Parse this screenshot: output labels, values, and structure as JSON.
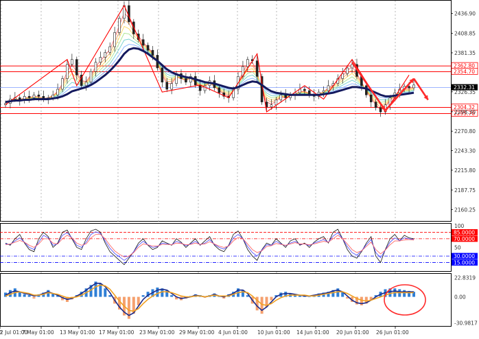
{
  "chart_data": [
    {
      "type": "line",
      "title": "",
      "xlabel": "",
      "ylabel": "",
      "price_ticks": [
        "2436.90",
        "2408.85",
        "2381.35",
        "2326.35",
        "2298.30",
        "2270.80",
        "2243.30",
        "2215.80",
        "2187.75",
        "2160.25"
      ],
      "ylim": [
        2148,
        2452
      ],
      "time_labels": [
        "7 May 01:00",
        "13 May 01:00",
        "17 May 01:00",
        "23 May 01:00",
        "29 May 01:00",
        "4 Jun 01:00",
        "10 Jun 01:00",
        "14 Jun 01:00",
        "20 Jun 01:00",
        "26 Jun 01:00",
        "2 Jul 01:00"
      ],
      "x_cut_label": "0",
      "price_series_desc": "candlestick price with ribbon of moving averages and thick navy moving average",
      "close": [
        2310,
        2316,
        2318,
        2314,
        2320,
        2318,
        2322,
        2320,
        2316,
        2318,
        2322,
        2330,
        2345,
        2365,
        2372,
        2350,
        2335,
        2340,
        2355,
        2368,
        2375,
        2382,
        2390,
        2410,
        2430,
        2448,
        2425,
        2408,
        2400,
        2392,
        2385,
        2378,
        2360,
        2340,
        2330,
        2338,
        2352,
        2345,
        2340,
        2348,
        2336,
        2328,
        2335,
        2342,
        2332,
        2325,
        2320,
        2318,
        2330,
        2348,
        2362,
        2372,
        2370,
        2348,
        2312,
        2305,
        2308,
        2315,
        2322,
        2318,
        2322,
        2325,
        2330,
        2328,
        2322,
        2320,
        2326,
        2328,
        2335,
        2338,
        2345,
        2352,
        2360,
        2365,
        2348,
        2335,
        2322,
        2312,
        2304,
        2298,
        2308,
        2318,
        2325,
        2330,
        2334,
        2332,
        2336
      ],
      "ma_slow": [
        2312,
        2313,
        2314,
        2314,
        2315,
        2315,
        2316,
        2316,
        2316,
        2316,
        2317,
        2318,
        2320,
        2323,
        2327,
        2329,
        2331,
        2333,
        2336,
        2340,
        2345,
        2350,
        2356,
        2363,
        2371,
        2380,
        2386,
        2388,
        2387,
        2384,
        2380,
        2375,
        2370,
        2364,
        2358,
        2354,
        2351,
        2349,
        2347,
        2346,
        2344,
        2342,
        2340,
        2339,
        2338,
        2336,
        2334,
        2332,
        2331,
        2333,
        2336,
        2339,
        2341,
        2340,
        2336,
        2331,
        2327,
        2325,
        2324,
        2323,
        2322,
        2322,
        2322,
        2322,
        2322,
        2322,
        2322,
        2323,
        2324,
        2325,
        2327,
        2329,
        2331,
        2333,
        2333,
        2332,
        2331,
        2328,
        2325,
        2322,
        2320,
        2320,
        2321,
        2322,
        2323,
        2324,
        2325
      ],
      "ribbon_fast": [
        2311,
        2315,
        2317,
        2315,
        2318,
        2318,
        2320,
        2319,
        2317,
        2318,
        2321,
        2327,
        2338,
        2355,
        2365,
        2355,
        2342,
        2341,
        2350,
        2362,
        2370,
        2378,
        2386,
        2402,
        2420,
        2438,
        2430,
        2415,
        2405,
        2396,
        2389,
        2381,
        2367,
        2350,
        2338,
        2338,
        2347,
        2345,
        2342,
        2346,
        2339,
        2332,
        2334,
        2339,
        2334,
        2328,
        2323,
        2320,
        2326,
        2340,
        2354,
        2366,
        2368,
        2355,
        2326,
        2312,
        2309,
        2313,
        2319,
        2318,
        2320,
        2323,
        2327,
        2327,
        2324,
        2321,
        2324,
        2326,
        2332,
        2336,
        2342,
        2349,
        2356,
        2362,
        2352,
        2340,
        2328,
        2317,
        2308,
        2301,
        2305,
        2314,
        2321,
        2327,
        2331,
        2331,
        2334
      ],
      "trend_lines": [
        {
          "color": "#ff0000",
          "points": [
            [
              0,
              2308
            ],
            [
              13,
              2372
            ],
            [
              15,
              2335
            ],
            [
              25,
              2448
            ],
            [
              33,
              2326
            ],
            [
              41,
              2336
            ],
            [
              47,
              2318
            ],
            [
              53,
              2380
            ],
            [
              55,
              2298
            ],
            [
              63,
              2335
            ],
            [
              67,
              2316
            ],
            [
              73,
              2372
            ],
            [
              80,
              2298
            ],
            [
              85,
              2350
            ]
          ]
        }
      ],
      "horizontal_levels": [
        {
          "value": 2362.8,
          "label": "2362.80",
          "color": "#ff0000"
        },
        {
          "value": 2354.7,
          "label": "2354.70",
          "color": "#ff0000"
        },
        {
          "value": 2304.32,
          "label": "2304.32",
          "color": "#ff0000"
        },
        {
          "value": 2295.7,
          "label": "2295.70",
          "color": "#ff0000"
        }
      ],
      "current_price": {
        "value": 2332.31,
        "label": "2332.31",
        "color": "#000000",
        "line_color": "#7b9cff"
      },
      "arrows": [
        {
          "from": [
            73,
            2368
          ],
          "to": [
            80,
            2300
          ],
          "color": "#ff2a2a"
        },
        {
          "from": [
            80,
            2300
          ],
          "to": [
            86,
            2345
          ],
          "color": "#ff2a2a"
        },
        {
          "from": [
            86,
            2345
          ],
          "to": [
            89,
            2315
          ],
          "color": "#ff2a2a"
        }
      ]
    },
    {
      "type": "line",
      "title": "",
      "ylim": [
        0,
        100
      ],
      "tick_labels": [
        "100",
        "50"
      ],
      "levels": [
        {
          "value": 85,
          "label": "85.0000",
          "color": "#ff0000"
        },
        {
          "value": 70,
          "label": "70.0000",
          "color": "#ff0000"
        },
        {
          "value": 30,
          "label": "30.0000",
          "color": "#0000ff"
        },
        {
          "value": 15,
          "label": "15.0000",
          "color": "#0000ff"
        }
      ],
      "series": [
        {
          "color": "#111111",
          "values": [
            60,
            55,
            70,
            80,
            60,
            45,
            40,
            70,
            85,
            75,
            50,
            60,
            85,
            90,
            70,
            50,
            45,
            70,
            88,
            92,
            85,
            60,
            40,
            30,
            20,
            10,
            25,
            40,
            60,
            70,
            55,
            45,
            50,
            65,
            60,
            55,
            70,
            62,
            50,
            60,
            70,
            55,
            65,
            75,
            55,
            45,
            40,
            55,
            80,
            88,
            70,
            45,
            30,
            20,
            45,
            60,
            55,
            70,
            60,
            50,
            65,
            70,
            55,
            60,
            50,
            62,
            70,
            75,
            60,
            85,
            92,
            70,
            45,
            30,
            25,
            40,
            60,
            75,
            30,
            15,
            45,
            70,
            80,
            65,
            78,
            72,
            70
          ]
        },
        {
          "color": "#4444ff",
          "values": [
            58,
            57,
            65,
            72,
            62,
            50,
            45,
            62,
            78,
            72,
            55,
            58,
            78,
            84,
            72,
            55,
            50,
            62,
            80,
            86,
            82,
            65,
            48,
            36,
            28,
            20,
            28,
            40,
            55,
            64,
            56,
            50,
            52,
            60,
            58,
            56,
            64,
            60,
            54,
            58,
            64,
            56,
            60,
            68,
            57,
            50,
            46,
            54,
            72,
            80,
            70,
            52,
            38,
            30,
            44,
            56,
            55,
            64,
            58,
            54,
            60,
            64,
            57,
            58,
            54,
            60,
            64,
            68,
            62,
            76,
            84,
            70,
            52,
            38,
            32,
            42,
            56,
            68,
            38,
            26,
            44,
            62,
            72,
            66,
            72,
            70,
            68
          ]
        },
        {
          "color": "#ff5a5a",
          "values": [
            56,
            58,
            62,
            66,
            62,
            55,
            50,
            58,
            70,
            70,
            60,
            58,
            70,
            78,
            72,
            60,
            55,
            58,
            72,
            80,
            80,
            70,
            55,
            42,
            34,
            28,
            30,
            38,
            50,
            58,
            56,
            53,
            53,
            57,
            57,
            56,
            60,
            59,
            56,
            57,
            60,
            57,
            58,
            63,
            58,
            53,
            50,
            53,
            65,
            73,
            70,
            58,
            45,
            38,
            42,
            52,
            54,
            59,
            57,
            55,
            58,
            61,
            58,
            58,
            56,
            58,
            61,
            64,
            62,
            70,
            78,
            70,
            58,
            45,
            38,
            42,
            52,
            62,
            45,
            35,
            44,
            56,
            65,
            65,
            67,
            68,
            67
          ]
        }
      ]
    },
    {
      "type": "bar",
      "title": "",
      "ylim": [
        -32,
        24
      ],
      "tick_labels": [
        "22.8319",
        "0.00",
        "-30.9817"
      ],
      "histogram": [
        5,
        8,
        10,
        6,
        3,
        2,
        -2,
        3,
        5,
        8,
        4,
        2,
        -4,
        -6,
        -3,
        2,
        6,
        10,
        14,
        18,
        16,
        10,
        2,
        -8,
        -15,
        -22,
        -26,
        -20,
        -10,
        2,
        6,
        9,
        11,
        10,
        8,
        2,
        -3,
        -4,
        -2,
        1,
        3,
        2,
        -1,
        2,
        4,
        1,
        -2,
        3,
        6,
        10,
        8,
        2,
        -8,
        -16,
        -20,
        -12,
        -4,
        2,
        5,
        6,
        4,
        3,
        2,
        1,
        0,
        2,
        4,
        5,
        6,
        8,
        10,
        6,
        -2,
        -6,
        -9,
        -10,
        -8,
        -4,
        2,
        6,
        9,
        10,
        10,
        9,
        8,
        7,
        6
      ],
      "hist_pos_color": "#2f7fd6",
      "hist_neg_color": "#f5a06e",
      "series": [
        {
          "color": "#1b2a8a",
          "values": [
            2,
            5,
            7,
            6,
            4,
            3,
            1,
            2,
            4,
            6,
            4,
            2,
            -1,
            -3,
            -2,
            1,
            4,
            8,
            12,
            16,
            16,
            12,
            5,
            -4,
            -12,
            -18,
            -22,
            -19,
            -11,
            -3,
            2,
            5,
            8,
            9,
            8,
            4,
            0,
            -2,
            -1,
            0,
            2,
            1,
            0,
            1,
            3,
            1,
            0,
            2,
            4,
            8,
            8,
            4,
            -4,
            -11,
            -16,
            -12,
            -6,
            0,
            3,
            4,
            4,
            3,
            2,
            1,
            1,
            2,
            3,
            4,
            5,
            7,
            8,
            6,
            1,
            -4,
            -7,
            -8,
            -7,
            -4,
            0,
            3,
            5,
            6,
            7,
            6,
            6,
            6,
            6
          ]
        },
        {
          "color": "#f0a020",
          "values": [
            1,
            3,
            5,
            6,
            5,
            4,
            2,
            2,
            3,
            5,
            4,
            3,
            1,
            -1,
            -1,
            0,
            2,
            5,
            8,
            12,
            14,
            13,
            9,
            2,
            -5,
            -11,
            -16,
            -17,
            -14,
            -8,
            -3,
            1,
            4,
            6,
            6,
            5,
            3,
            1,
            0,
            0,
            1,
            1,
            0,
            1,
            2,
            1,
            1,
            1,
            3,
            5,
            6,
            5,
            1,
            -4,
            -9,
            -10,
            -8,
            -4,
            -1,
            1,
            2,
            2,
            2,
            2,
            1,
            1,
            2,
            3,
            4,
            5,
            6,
            6,
            4,
            1,
            -2,
            -4,
            -5,
            -4,
            -2,
            0,
            2,
            4,
            5,
            5,
            5,
            5,
            5
          ]
        }
      ]
    }
  ],
  "annotation": {
    "shape": "ellipse",
    "color": "#ff2a2a"
  },
  "colors": {
    "grid": "#9a9a9a",
    "ribbon": [
      "#ff4d4d",
      "#ff9a3c",
      "#ffd23c",
      "#9be07a",
      "#58c7c7",
      "#6aa0ff",
      "#b07aff"
    ]
  }
}
